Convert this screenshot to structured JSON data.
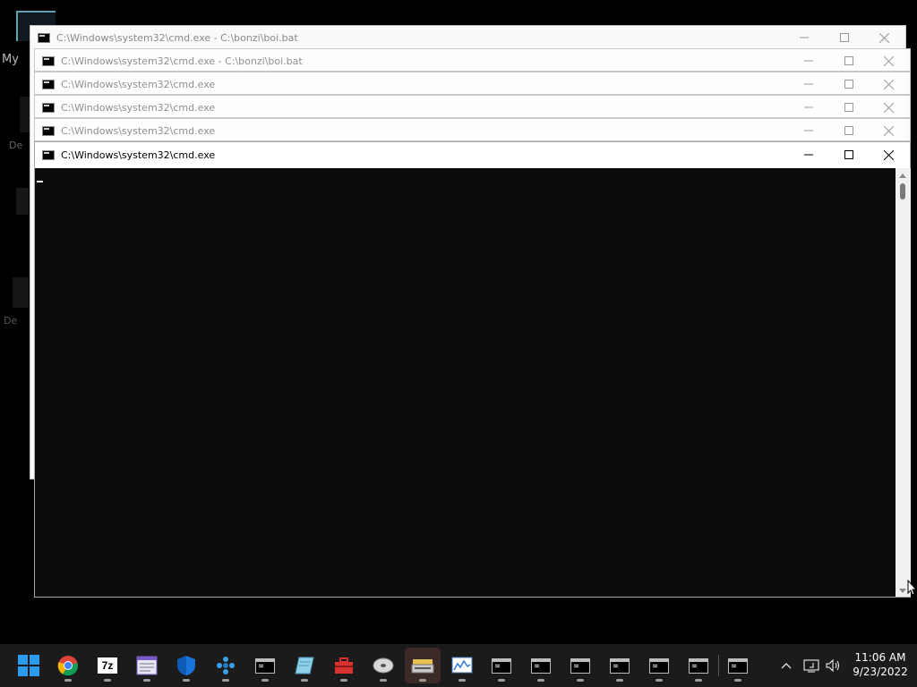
{
  "desktop": {
    "icon_label_fragments": [
      "My",
      "De",
      "De"
    ]
  },
  "windows": [
    {
      "title": "C:\\Windows\\system32\\cmd.exe - C:\\bonzi\\boi.bat"
    },
    {
      "title": "C:\\Windows\\system32\\cmd.exe - C:\\bonzi\\boi.bat"
    },
    {
      "title": "C:\\Windows\\system32\\cmd.exe"
    },
    {
      "title": "C:\\Windows\\system32\\cmd.exe"
    },
    {
      "title": "C:\\Windows\\system32\\cmd.exe"
    },
    {
      "title": "C:\\Windows\\system32\\cmd.exe"
    }
  ],
  "taskbar": {
    "items": [
      {
        "name": "start-button",
        "icon": "windows-logo-icon"
      },
      {
        "name": "chrome",
        "icon": "chrome-icon"
      },
      {
        "name": "7zip",
        "icon": "7zip-icon",
        "label": "7z"
      },
      {
        "name": "app-window",
        "icon": "app-window-icon"
      },
      {
        "name": "defender",
        "icon": "shield-icon"
      },
      {
        "name": "network-app",
        "icon": "network-icon"
      },
      {
        "name": "cmd-1",
        "icon": "cmd-icon"
      },
      {
        "name": "notepad",
        "icon": "notepad-icon"
      },
      {
        "name": "toolbox",
        "icon": "toolbox-icon"
      },
      {
        "name": "disc-app",
        "icon": "disc-icon"
      },
      {
        "name": "scanner-app",
        "icon": "scanner-icon"
      },
      {
        "name": "monitor-app",
        "icon": "monitor-icon"
      },
      {
        "name": "cmd-2",
        "icon": "cmd-icon"
      },
      {
        "name": "cmd-3",
        "icon": "cmd-icon"
      },
      {
        "name": "cmd-4",
        "icon": "cmd-icon"
      },
      {
        "name": "cmd-5",
        "icon": "cmd-icon"
      },
      {
        "name": "cmd-6",
        "icon": "cmd-icon"
      },
      {
        "name": "cmd-7",
        "icon": "cmd-icon"
      },
      {
        "name": "cmd-8",
        "icon": "cmd-icon"
      }
    ],
    "clock_time": "11:06 AM",
    "clock_date": "9/23/2022"
  },
  "colors": {
    "taskbar_bg": "#1b1b1b",
    "console_bg": "#0c0c0c",
    "windows_blue": "#0078d4"
  }
}
